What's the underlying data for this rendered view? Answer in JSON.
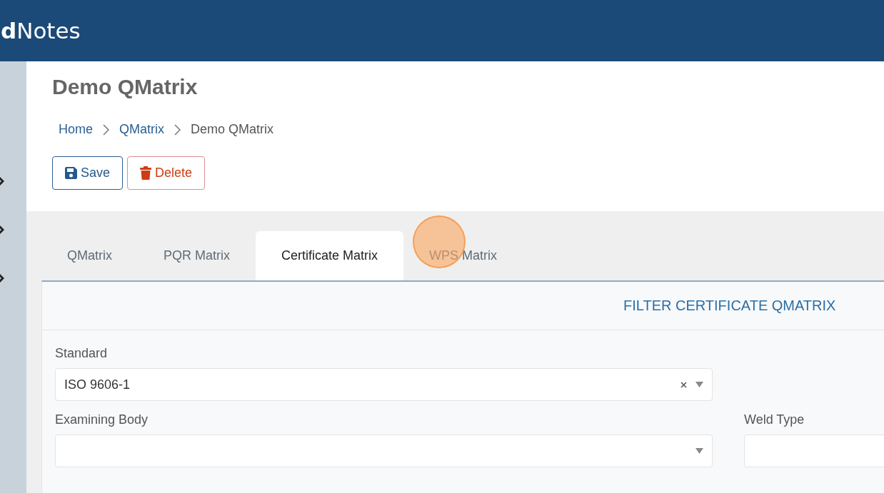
{
  "header": {
    "brand": "dNotes"
  },
  "page": {
    "title": "Demo QMatrix",
    "breadcrumb": [
      {
        "label": "Home",
        "link": true
      },
      {
        "label": "QMatrix",
        "link": true
      },
      {
        "label": "Demo QMatrix",
        "link": false
      }
    ],
    "buttons": [
      {
        "label": "Save",
        "kind": "save"
      },
      {
        "label": "Delete",
        "kind": "delete"
      }
    ]
  },
  "tabs": [
    {
      "label": "QMatrix",
      "selected": false
    },
    {
      "label": "PQR Matrix",
      "selected": false
    },
    {
      "label": "Certificate Matrix",
      "selected": true
    },
    {
      "label": "WPS Matrix",
      "selected": false
    }
  ],
  "filter": {
    "title": "FILTER CERTIFICATE QMATRIX",
    "fields": [
      {
        "label": "Standard",
        "value": "ISO 9606-1",
        "clearable": true,
        "kind": "select"
      },
      {
        "label": "Examining Body",
        "clearable": false,
        "kind": "select"
      },
      {
        "label": "Weld Type",
        "clearable": false,
        "kind": "side"
      }
    ]
  }
}
